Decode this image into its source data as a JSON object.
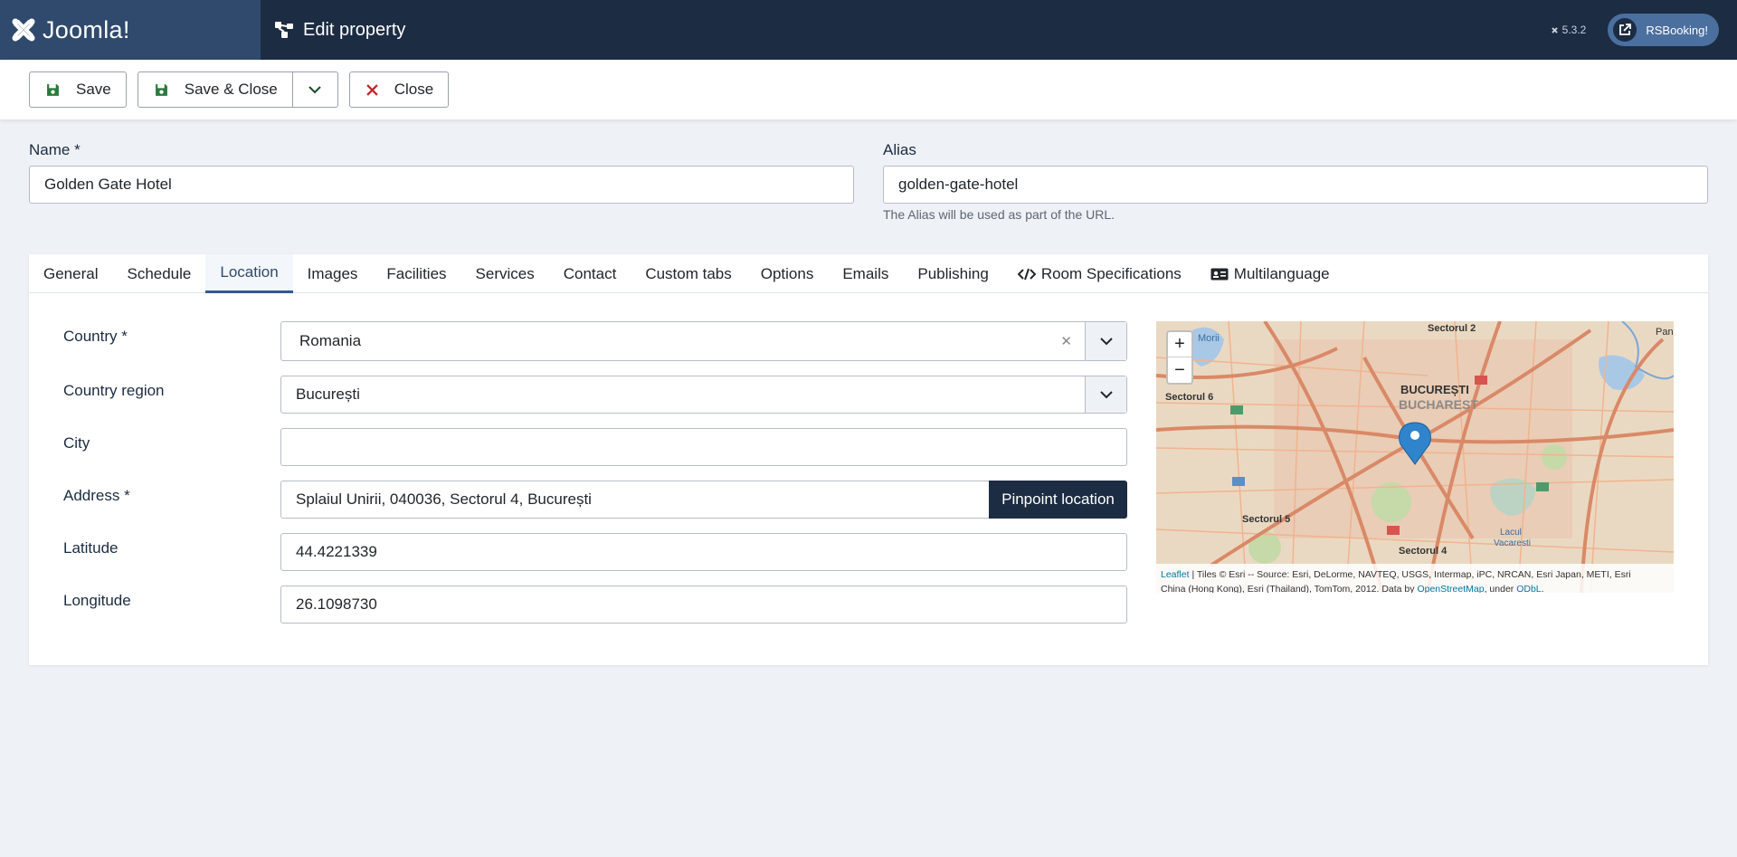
{
  "header": {
    "logo_text": "Joomla!",
    "title": "Edit property",
    "version": "5.3.2",
    "ext_button": "RSBooking!"
  },
  "toolbar": {
    "save": "Save",
    "save_close": "Save & Close",
    "close": "Close"
  },
  "form": {
    "name_label": "Name *",
    "name_value": "Golden Gate Hotel",
    "alias_label": "Alias",
    "alias_value": "golden-gate-hotel",
    "alias_hint": "The Alias will be used as part of the URL."
  },
  "tabs": [
    {
      "label": "General"
    },
    {
      "label": "Schedule"
    },
    {
      "label": "Location"
    },
    {
      "label": "Images"
    },
    {
      "label": "Facilities"
    },
    {
      "label": "Services"
    },
    {
      "label": "Contact"
    },
    {
      "label": "Custom tabs"
    },
    {
      "label": "Options"
    },
    {
      "label": "Emails"
    },
    {
      "label": "Publishing"
    },
    {
      "label": "Room Specifications"
    },
    {
      "label": "Multilanguage"
    }
  ],
  "location": {
    "country_label": "Country *",
    "country_value": "Romania",
    "region_label": "Country region",
    "region_value": "București",
    "city_label": "City",
    "city_value": "",
    "address_label": "Address *",
    "address_value": "Splaiul Unirii, 040036, Sectorul 4, București",
    "pinpoint_button": "Pinpoint location",
    "latitude_label": "Latitude",
    "latitude_value": "44.4221339",
    "longitude_label": "Longitude",
    "longitude_value": "26.1098730"
  },
  "map": {
    "zoom_in": "+",
    "zoom_out": "−",
    "labels": {
      "city_ro": "BUCUREȘTI",
      "city_en": "BUCHAREST",
      "sector2": "Sectorul 2",
      "sector6": "Sectorul 6",
      "sector5": "Sectorul 5",
      "sector4": "Sectorul 4",
      "morii": "Morii",
      "pan": "Pan",
      "lacul": "Lacul",
      "vacaresti": "Vacaresti"
    },
    "attribution": {
      "leaflet": "Leaflet",
      "text1": " | Tiles © Esri -- Source: Esri, DeLorme, NAVTEQ, USGS, Intermap, iPC, NRCAN, Esri Japan, METI, Esri",
      "text2": "China (Hong Kong), Esri (Thailand), TomTom, 2012. Data by ",
      "osm": "OpenStreetMap",
      "under": ", under ",
      "odbl": "ODbL",
      "end": "."
    }
  }
}
